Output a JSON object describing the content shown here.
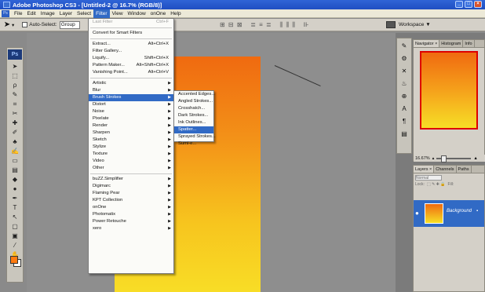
{
  "app": {
    "title": "Adobe Photoshop CS3 - [Untitled-2 @ 16.7% (RGB/8)]"
  },
  "menubar": {
    "items": [
      "File",
      "Edit",
      "Image",
      "Layer",
      "Select",
      "Filter",
      "View",
      "Window",
      "onOne",
      "Help"
    ],
    "active_index": 5
  },
  "options": {
    "auto_select_label": "Auto-Select:",
    "auto_select_value": "Group",
    "workspace_label": "Workspace ▼"
  },
  "filter_menu": {
    "items": [
      {
        "label": "Last Filter",
        "shortcut": "Ctrl+F",
        "disabled": true
      },
      {
        "sep": true
      },
      {
        "label": "Convert for Smart Filters"
      },
      {
        "sep": true
      },
      {
        "label": "Extract...",
        "shortcut": "Alt+Ctrl+X"
      },
      {
        "label": "Filter Gallery..."
      },
      {
        "label": "Liquify...",
        "shortcut": "Shift+Ctrl+X"
      },
      {
        "label": "Pattern Maker...",
        "shortcut": "Alt+Shift+Ctrl+X"
      },
      {
        "label": "Vanishing Point...",
        "shortcut": "Alt+Ctrl+V"
      },
      {
        "sep": true
      },
      {
        "label": "Artistic",
        "sub": true
      },
      {
        "label": "Blur",
        "sub": true
      },
      {
        "label": "Brush Strokes",
        "sub": true,
        "highlight": true
      },
      {
        "label": "Distort",
        "sub": true
      },
      {
        "label": "Noise",
        "sub": true
      },
      {
        "label": "Pixelate",
        "sub": true
      },
      {
        "label": "Render",
        "sub": true
      },
      {
        "label": "Sharpen",
        "sub": true
      },
      {
        "label": "Sketch",
        "sub": true
      },
      {
        "label": "Stylize",
        "sub": true
      },
      {
        "label": "Texture",
        "sub": true
      },
      {
        "label": "Video",
        "sub": true
      },
      {
        "label": "Other",
        "sub": true
      },
      {
        "sep": true
      },
      {
        "label": "buZZ.Simplifier",
        "sub": true
      },
      {
        "label": "Digimarc",
        "sub": true
      },
      {
        "label": "Flaming Pear",
        "sub": true
      },
      {
        "label": "KPT Collection",
        "sub": true
      },
      {
        "label": "onOne",
        "sub": true
      },
      {
        "label": "Photomatix",
        "sub": true
      },
      {
        "label": "Power Retouche",
        "sub": true
      },
      {
        "label": "xero",
        "sub": true
      }
    ]
  },
  "brush_strokes_menu": {
    "items": [
      {
        "label": "Accented Edges..."
      },
      {
        "label": "Angled Strokes..."
      },
      {
        "label": "Crosshatch..."
      },
      {
        "label": "Dark Strokes..."
      },
      {
        "label": "Ink Outlines..."
      },
      {
        "label": "Spatter...",
        "highlight": true
      },
      {
        "label": "Sprayed Strokes..."
      },
      {
        "label": "Sumi-e..."
      }
    ]
  },
  "navigator": {
    "tabs": [
      "Navigator ×",
      "Histogram",
      "Info"
    ],
    "zoom": "16.67%"
  },
  "layers": {
    "tabs": [
      "Layers ×",
      "Channels",
      "Paths"
    ],
    "blend_mode": "Normal",
    "lock_label": "Lock:",
    "fill_label": "Fill:",
    "layer_name": "Background"
  },
  "colors": {
    "accent": "#316ac5",
    "foreground": "#ff7a10",
    "background": "#ffffff"
  }
}
